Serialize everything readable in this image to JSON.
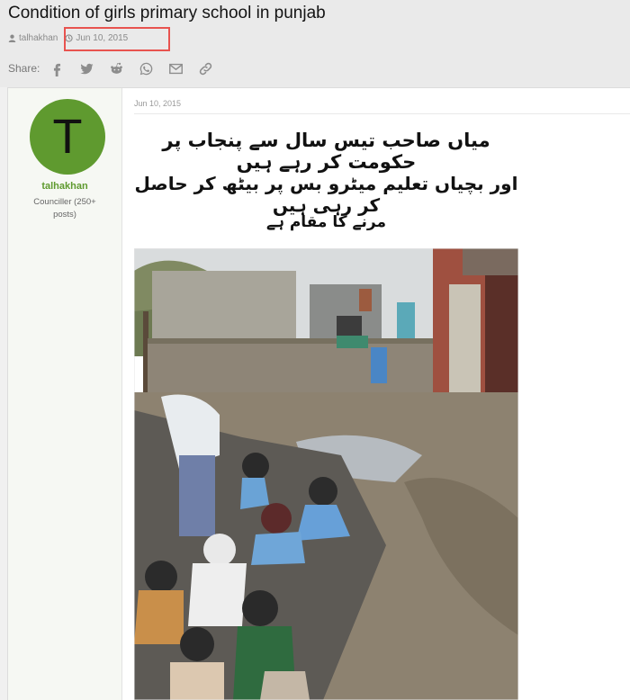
{
  "thread": {
    "title": "Condition of girls primary school in punjab",
    "author": "talhakhan",
    "date": "Jun 10, 2015"
  },
  "share": {
    "label": "Share:",
    "icons": [
      "facebook-icon",
      "twitter-icon",
      "reddit-icon",
      "whatsapp-icon",
      "email-icon",
      "link-icon"
    ]
  },
  "post": {
    "avatar_letter": "T",
    "username": "talhakhan",
    "user_title": "Counciller (250+ posts)",
    "date": "Jun 10, 2015",
    "image_text": {
      "line1": "میاں صاحب تیس سال سے پنجاب پر حکومت کر رہے ہیں",
      "line2": "اور بچیاں تعلیم میٹرو بس پر بیٹھ کر حاصل کر رہی ہیں",
      "line3": "مرنے کا مقام ہے"
    }
  },
  "colors": {
    "accent_green": "#5f9a2f",
    "highlight_red": "#e8534f"
  }
}
